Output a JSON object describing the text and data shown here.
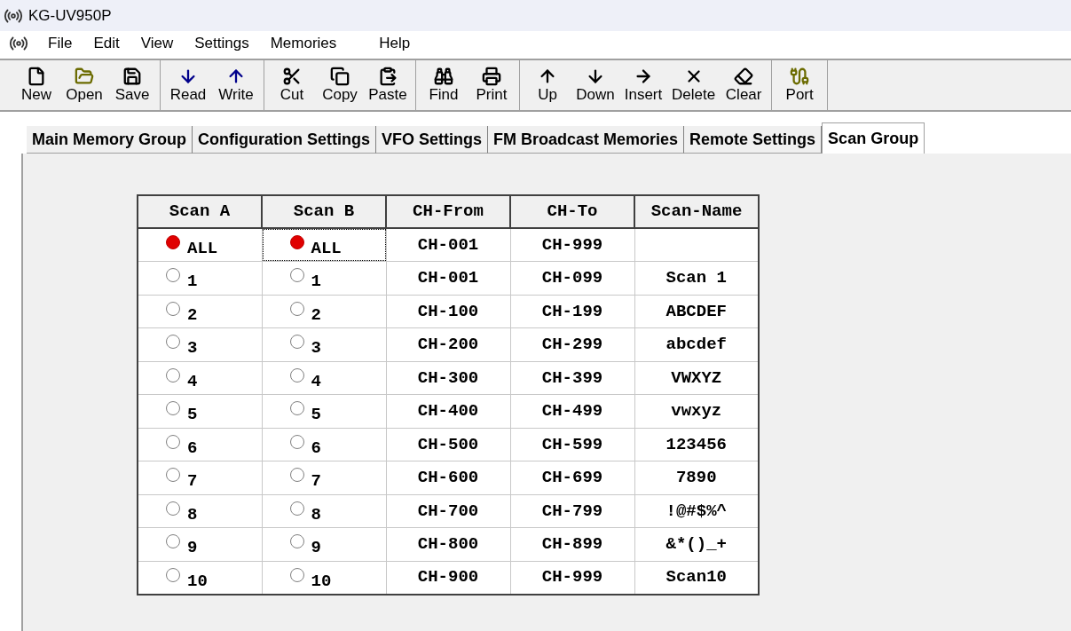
{
  "window": {
    "title": "KG-UV950P"
  },
  "menu": [
    "File",
    "Edit",
    "View",
    "Settings",
    "Memories",
    "Help"
  ],
  "toolbar": [
    [
      "New",
      "Open",
      "Save"
    ],
    [
      "Read",
      "Write"
    ],
    [
      "Cut",
      "Copy",
      "Paste"
    ],
    [
      "Find",
      "Print"
    ],
    [
      "Up",
      "Down",
      "Insert",
      "Delete",
      "Clear"
    ],
    [
      "Port"
    ]
  ],
  "tabs": [
    {
      "label": "Main Memory Group",
      "selected": false
    },
    {
      "label": "Configuration Settings",
      "selected": false
    },
    {
      "label": "VFO Settings",
      "selected": false
    },
    {
      "label": "FM Broadcast Memories",
      "selected": false
    },
    {
      "label": "Remote Settings",
      "selected": false
    },
    {
      "label": "Scan Group",
      "selected": true
    }
  ],
  "table": {
    "columns": [
      "Scan A",
      "Scan B",
      "CH-From",
      "CH-To",
      "Scan-Name"
    ],
    "rows": [
      {
        "scan_a": {
          "label": "ALL",
          "selected": true
        },
        "scan_b": {
          "label": "ALL",
          "selected": true,
          "focused": true
        },
        "ch_from": "CH-001",
        "ch_to": "CH-999",
        "scan_name": ""
      },
      {
        "scan_a": {
          "label": "1",
          "selected": false
        },
        "scan_b": {
          "label": "1",
          "selected": false,
          "focused": false
        },
        "ch_from": "CH-001",
        "ch_to": "CH-099",
        "scan_name": "Scan 1"
      },
      {
        "scan_a": {
          "label": "2",
          "selected": false
        },
        "scan_b": {
          "label": "2",
          "selected": false,
          "focused": false
        },
        "ch_from": "CH-100",
        "ch_to": "CH-199",
        "scan_name": "ABCDEF"
      },
      {
        "scan_a": {
          "label": "3",
          "selected": false
        },
        "scan_b": {
          "label": "3",
          "selected": false,
          "focused": false
        },
        "ch_from": "CH-200",
        "ch_to": "CH-299",
        "scan_name": "abcdef"
      },
      {
        "scan_a": {
          "label": "4",
          "selected": false
        },
        "scan_b": {
          "label": "4",
          "selected": false,
          "focused": false
        },
        "ch_from": "CH-300",
        "ch_to": "CH-399",
        "scan_name": "VWXYZ"
      },
      {
        "scan_a": {
          "label": "5",
          "selected": false
        },
        "scan_b": {
          "label": "5",
          "selected": false,
          "focused": false
        },
        "ch_from": "CH-400",
        "ch_to": "CH-499",
        "scan_name": "vwxyz"
      },
      {
        "scan_a": {
          "label": "6",
          "selected": false
        },
        "scan_b": {
          "label": "6",
          "selected": false,
          "focused": false
        },
        "ch_from": "CH-500",
        "ch_to": "CH-599",
        "scan_name": "123456"
      },
      {
        "scan_a": {
          "label": "7",
          "selected": false
        },
        "scan_b": {
          "label": "7",
          "selected": false,
          "focused": false
        },
        "ch_from": "CH-600",
        "ch_to": "CH-699",
        "scan_name": "7890"
      },
      {
        "scan_a": {
          "label": "8",
          "selected": false
        },
        "scan_b": {
          "label": "8",
          "selected": false,
          "focused": false
        },
        "ch_from": "CH-700",
        "ch_to": "CH-799",
        "scan_name": "!@#$%^"
      },
      {
        "scan_a": {
          "label": "9",
          "selected": false
        },
        "scan_b": {
          "label": "9",
          "selected": false,
          "focused": false
        },
        "ch_from": "CH-800",
        "ch_to": "CH-899",
        "scan_name": "&*()_+"
      },
      {
        "scan_a": {
          "label": "10",
          "selected": false
        },
        "scan_b": {
          "label": "10",
          "selected": false,
          "focused": false
        },
        "ch_from": "CH-900",
        "ch_to": "CH-999",
        "scan_name": "Scan10"
      }
    ]
  }
}
